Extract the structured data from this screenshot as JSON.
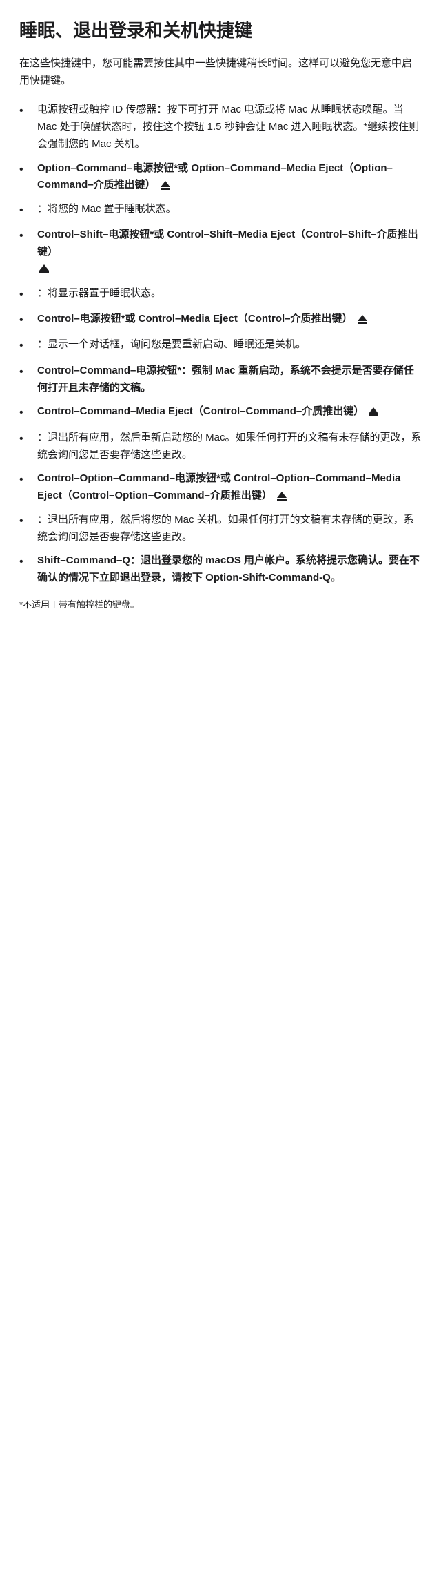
{
  "page": {
    "title": "睡眠、退出登录和关机快捷键",
    "intro": "在这些快捷键中，您可能需要按住其中一些快捷键稍长时间。这样可以避免您无意中启用快捷键。",
    "items": [
      {
        "type": "bullet",
        "bold_part": "",
        "full_text": "电源按钮或触控 ID 传感器：按下可打开 Mac 电源或将 Mac 从睡眠状态唤醒。当 Mac 处于唤醒状态时，按住这个按钮 1.5 秒钟会让 Mac 进入睡眠状态。*继续按住则会强制您的 Mac 关机。"
      },
      {
        "type": "bullet",
        "has_bold": true,
        "bold_part": "Option–Command–电源按钮*或 Option–Command–Media Eject（Option–Command–介质推出键）",
        "eject": true
      },
      {
        "type": "colon",
        "text": "：将您的 Mac 置于睡眠状态。"
      },
      {
        "type": "bullet",
        "has_bold": true,
        "bold_part": "Control–Shift–电源按钮*或 Control–Shift–Media Eject（Control–Shift–介质推出键）",
        "eject": true
      },
      {
        "type": "colon",
        "text": "：将显示器置于睡眠状态。"
      },
      {
        "type": "bullet",
        "has_bold": true,
        "bold_part": "Control–电源按钮*或 Control–Media Eject（Control–介质推出键）",
        "eject": true
      },
      {
        "type": "colon",
        "text": "：显示一个对话框，询问您是要重新启动、睡眠还是关机。"
      },
      {
        "type": "bullet",
        "has_bold": true,
        "bold_part": "Control–Command–电源按钮*：强制 Mac 重新启动，系统不会提示是否要存储任何打开且未存储的文稿。",
        "eject": false
      },
      {
        "type": "bullet",
        "has_bold": true,
        "bold_part": "Control–Command–Media Eject（Control–Command–介质推出键）",
        "eject": true
      },
      {
        "type": "colon",
        "text": "：退出所有应用，然后重新启动您的 Mac。如果任何打开的文稿有未存储的更改，系统会询问您是否要存储这些更改。"
      },
      {
        "type": "bullet",
        "has_bold": true,
        "bold_part": "Control–Option–Command–电源按钮*或 Control–Option–Command–Media Eject（Control–Option–Command–介质推出键）",
        "eject": true
      },
      {
        "type": "colon",
        "text": "：退出所有应用，然后将您的 Mac 关机。如果任何打开的文稿有未存储的更改，系统会询问您是否要存储这些更改。"
      },
      {
        "type": "bullet",
        "has_bold": true,
        "bold_part": "Shift–Command–Q：退出登录您的 macOS 用户帐户。系统将提示您确认。要在不确认的情况下立即退出登录，请按下 Option-Shift-Command-Q。",
        "eject": false
      }
    ],
    "footnote": "*不适用于带有触控栏的键盘。"
  }
}
